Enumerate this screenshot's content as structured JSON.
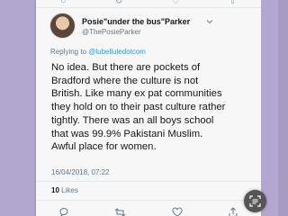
{
  "tweet": {
    "display_name": "Posie\"under the bus\"Parker",
    "handle": "@ThePosieParker",
    "reply_prefix": "Replying to ",
    "reply_handle": "@lubelluledotcom",
    "text": "No idea.  But there are pockets of\nBradford where the culture is not\nBritish. Like many ex pat communities\nthey hold on to their past culture rather\ntightly.  There was an all boys school\nthat was 99.9% Pakistani Muslim.\nAwful place for women.",
    "timestamp": "16/04/2018, 07:22",
    "likes_count": "10",
    "likes_label": "Likes"
  },
  "icons": {
    "top": [
      "comment-icon",
      "retweet-icon",
      "like-icon",
      "share-icon"
    ],
    "bottom": [
      "comment-icon",
      "retweet-icon",
      "like-icon",
      "share-icon"
    ],
    "dropdown": "chevron-down-icon",
    "fab": "scan-text-icon"
  },
  "colors": {
    "background": "#a79bc5",
    "card": "#f7f7f7",
    "link": "#1da1f2",
    "muted": "#657786"
  }
}
